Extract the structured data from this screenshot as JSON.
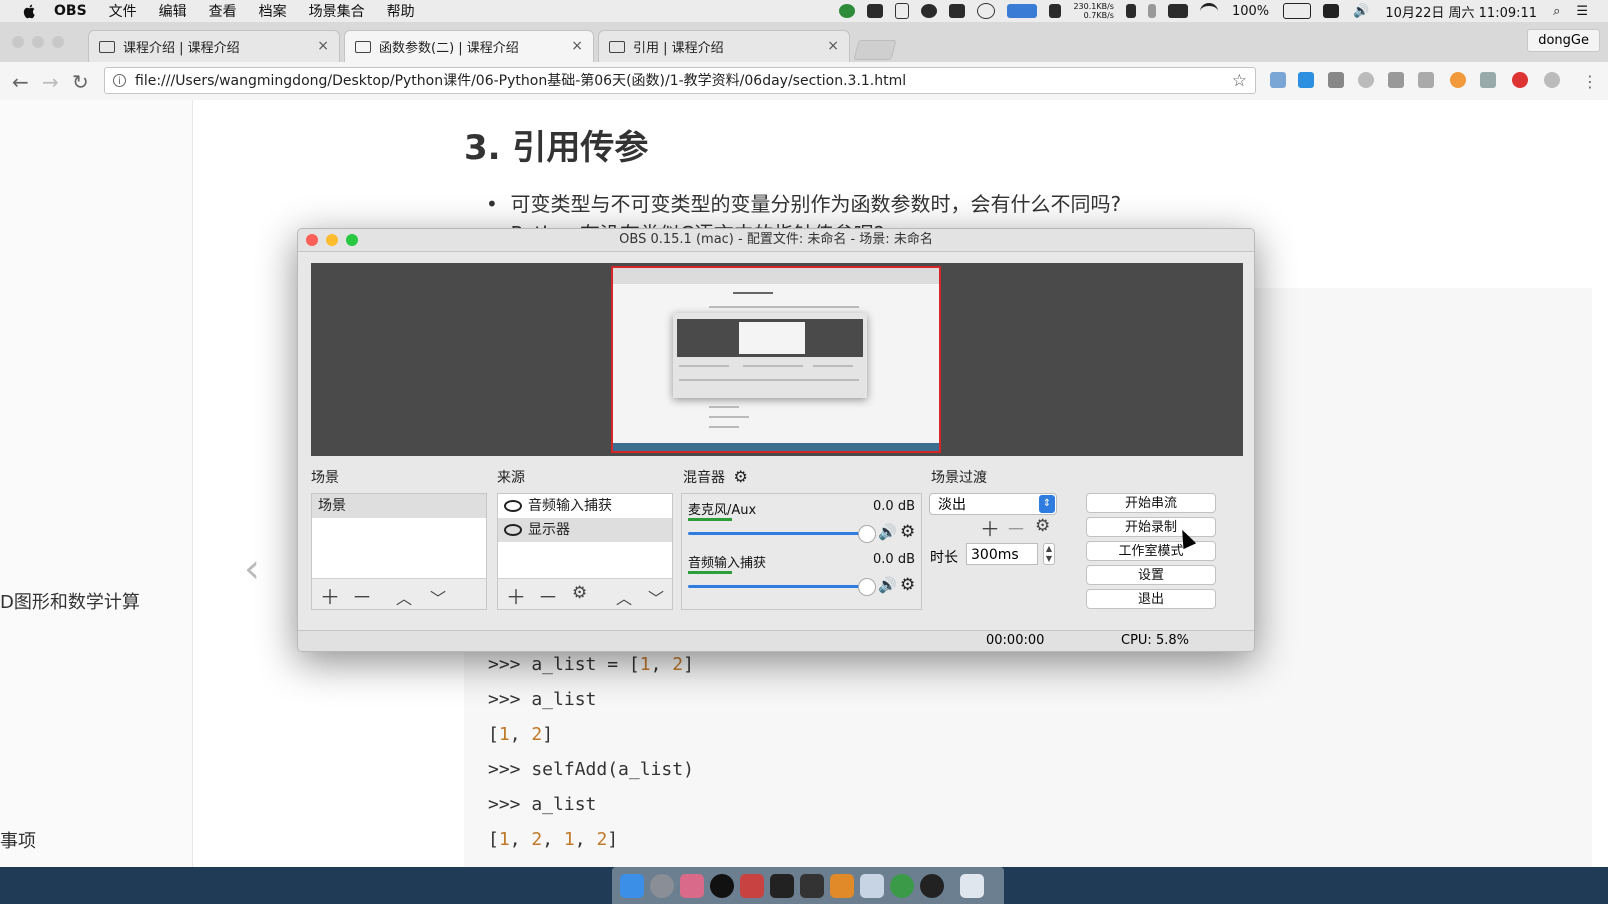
{
  "menubar": {
    "app": "OBS",
    "items": [
      "文件",
      "编辑",
      "查看",
      "档案",
      "场景集合",
      "帮助"
    ],
    "net_up": "230.1KB/s",
    "net_down": "0.7KB/s",
    "battery": "100%",
    "datetime": "10月22日 周六 11:09:11"
  },
  "browser": {
    "tabs": [
      {
        "title": "课程介绍 | 课程介绍"
      },
      {
        "title": "函数参数(二) | 课程介绍"
      },
      {
        "title": "引用 | 课程介绍"
      }
    ],
    "profile": "dongGe",
    "url": "file:///Users/wangmingdong/Desktop/Python课件/06-Python基础-第06天(函数)/1-教学资料/06day/section.3.1.html"
  },
  "page": {
    "heading": "3. 引用传参",
    "bullet1": "可变类型与不可变类型的变量分别作为函数参数时，会有什么不同吗?",
    "bullet2": "Python有没有类似C语言中的指针传参呢?",
    "sidebar_item1": "D图形和数学计算",
    "sidebar_item2": "事项",
    "code": {
      "l1_prefix": ">>> a_list = [",
      "l1_n1": "1",
      "l1_sep": ", ",
      "l1_n2": "2",
      "l1_end": "]",
      "l2": ">>> a_list",
      "l3_open": "[",
      "l3_n1": "1",
      "l3_sep": ", ",
      "l3_n2": "2",
      "l3_close": "]",
      "l4": ">>> selfAdd(a_list)",
      "l5": ">>> a_list",
      "l6_open": "[",
      "l6_n1": "1",
      "l6_n2": "2",
      "l6_n3": "1",
      "l6_n4": "2",
      "l6_sep": ", ",
      "l6_close": "]"
    }
  },
  "obs": {
    "title": "OBS 0.15.1 (mac) - 配置文件: 未命名 - 场景: 未命名",
    "scenes_label": "场景",
    "scenes": [
      "场景"
    ],
    "sources_label": "来源",
    "sources": [
      "音频输入捕获",
      "显示器"
    ],
    "mixer_label": "混音器",
    "channels": [
      {
        "name": "麦克风/Aux",
        "db": "0.0 dB"
      },
      {
        "name": "音频输入捕获",
        "db": "0.0 dB"
      }
    ],
    "transition_label": "场景过渡",
    "transition": "淡出",
    "duration_label": "时长",
    "duration": "300ms",
    "buttons": {
      "stream": "开始串流",
      "record": "开始录制",
      "studio": "工作室模式",
      "settings": "设置",
      "exit": "退出"
    },
    "status_time": "00:00:00",
    "status_cpu": "CPU: 5.8%"
  }
}
